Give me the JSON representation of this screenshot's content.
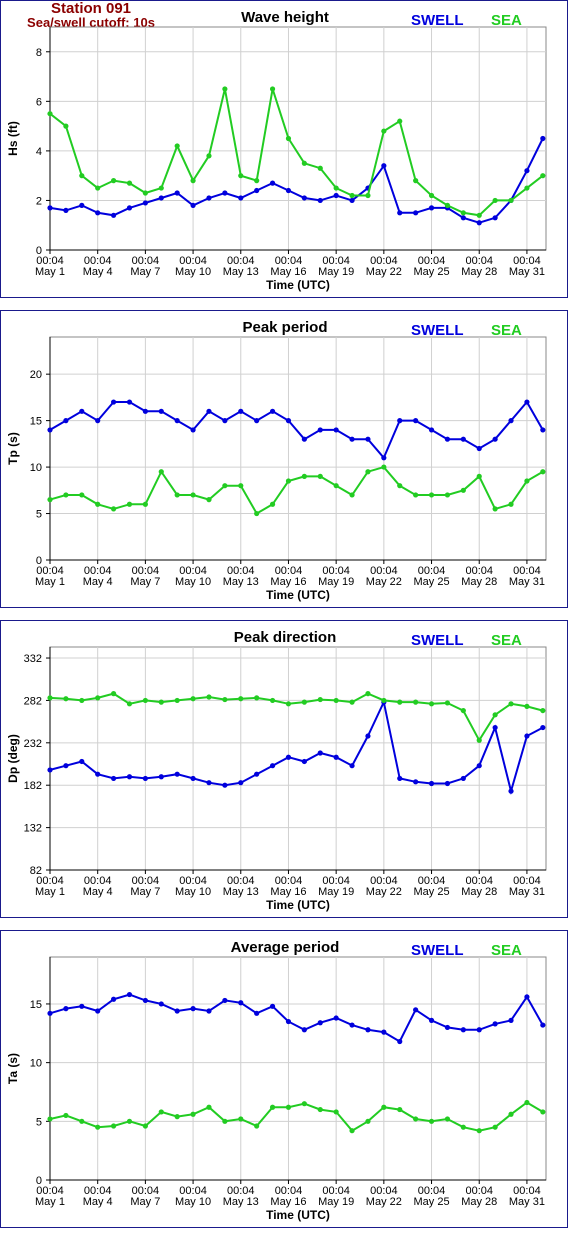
{
  "header": {
    "station": "Station 091",
    "cutoff": "Sea/swell cutoff: 10s"
  },
  "colors": {
    "swell": "#0000dd",
    "sea": "#22cc22",
    "grid": "#d0d0d0",
    "axis": "#000000",
    "frame": "#1a1a8c"
  },
  "legend": {
    "swell": "SWELL",
    "sea": "SEA"
  },
  "xaxis": {
    "label": "Time (UTC)",
    "ticks": [
      {
        "time": "00:04",
        "date": "May 1"
      },
      {
        "time": "00:04",
        "date": "May 4"
      },
      {
        "time": "00:04",
        "date": "May 7"
      },
      {
        "time": "00:04",
        "date": "May 10"
      },
      {
        "time": "00:04",
        "date": "May 13"
      },
      {
        "time": "00:04",
        "date": "May 16"
      },
      {
        "time": "00:04",
        "date": "May 19"
      },
      {
        "time": "00:04",
        "date": "May 22"
      },
      {
        "time": "00:04",
        "date": "May 25"
      },
      {
        "time": "00:04",
        "date": "May 28"
      },
      {
        "time": "00:04",
        "date": "May 31"
      }
    ]
  },
  "chart_data": [
    {
      "type": "line",
      "title": "Wave height",
      "ylabel": "Hs (ft)",
      "xlabel": "Time (UTC)",
      "ylim": [
        0,
        9
      ],
      "yticks": [
        0,
        2,
        4,
        6,
        8
      ],
      "x_unit": "day of May",
      "grid": true,
      "legend": "top-right",
      "series": [
        {
          "name": "SWELL",
          "x": [
            1,
            2,
            3,
            4,
            5,
            6,
            7,
            8,
            9,
            10,
            11,
            12,
            13,
            14,
            15,
            16,
            17,
            18,
            19,
            20,
            21,
            22,
            23,
            24,
            25,
            26,
            27,
            28,
            29,
            30,
            31,
            32
          ],
          "values": [
            1.7,
            1.6,
            1.8,
            1.5,
            1.4,
            1.7,
            1.9,
            2.1,
            2.3,
            1.8,
            2.1,
            2.3,
            2.1,
            2.4,
            2.7,
            2.4,
            2.1,
            2.0,
            2.2,
            2.0,
            2.5,
            3.4,
            1.5,
            1.5,
            1.7,
            1.7,
            1.3,
            1.1,
            1.3,
            2.0,
            3.2,
            4.5
          ]
        },
        {
          "name": "SEA",
          "x": [
            1,
            2,
            3,
            4,
            5,
            6,
            7,
            8,
            9,
            10,
            11,
            12,
            13,
            14,
            15,
            16,
            17,
            18,
            19,
            20,
            21,
            22,
            23,
            24,
            25,
            26,
            27,
            28,
            29,
            30,
            31,
            32
          ],
          "values": [
            5.5,
            5.0,
            3.0,
            2.5,
            2.8,
            2.7,
            2.3,
            2.5,
            4.2,
            2.8,
            3.8,
            6.5,
            3.0,
            2.8,
            6.5,
            4.5,
            3.5,
            3.3,
            2.5,
            2.2,
            2.2,
            4.8,
            5.2,
            2.8,
            2.2,
            1.8,
            1.5,
            1.4,
            2.0,
            2.0,
            2.5,
            3.0
          ]
        }
      ]
    },
    {
      "type": "line",
      "title": "Peak period",
      "ylabel": "Tp (s)",
      "xlabel": "Time (UTC)",
      "ylim": [
        0,
        24
      ],
      "yticks": [
        0,
        5,
        10,
        15,
        20
      ],
      "x_unit": "day of May",
      "grid": true,
      "legend": "top-right",
      "series": [
        {
          "name": "SWELL",
          "x": [
            1,
            2,
            3,
            4,
            5,
            6,
            7,
            8,
            9,
            10,
            11,
            12,
            13,
            14,
            15,
            16,
            17,
            18,
            19,
            20,
            21,
            22,
            23,
            24,
            25,
            26,
            27,
            28,
            29,
            30,
            31,
            32
          ],
          "values": [
            14,
            15,
            16,
            15,
            17,
            17,
            16,
            16,
            15,
            14,
            16,
            15,
            16,
            15,
            16,
            15,
            13,
            14,
            14,
            13,
            13,
            11,
            15,
            15,
            14,
            13,
            13,
            12,
            13,
            15,
            17,
            14
          ]
        },
        {
          "name": "SEA",
          "x": [
            1,
            2,
            3,
            4,
            5,
            6,
            7,
            8,
            9,
            10,
            11,
            12,
            13,
            14,
            15,
            16,
            17,
            18,
            19,
            20,
            21,
            22,
            23,
            24,
            25,
            26,
            27,
            28,
            29,
            30,
            31,
            32
          ],
          "values": [
            6.5,
            7,
            7,
            6,
            5.5,
            6,
            6,
            9.5,
            7,
            7,
            6.5,
            8,
            8,
            5,
            6,
            8.5,
            9,
            9,
            8,
            7,
            9.5,
            10,
            8,
            7,
            7,
            7,
            7.5,
            9,
            5.5,
            6,
            8.5,
            9.5
          ]
        }
      ]
    },
    {
      "type": "line",
      "title": "Peak direction",
      "ylabel": "Dp (deg)",
      "xlabel": "Time (UTC)",
      "ylim": [
        82,
        345
      ],
      "yticks": [
        82,
        132,
        182,
        232,
        282,
        332
      ],
      "x_unit": "day of May",
      "grid": true,
      "legend": "top-right",
      "series": [
        {
          "name": "SWELL",
          "x": [
            1,
            2,
            3,
            4,
            5,
            6,
            7,
            8,
            9,
            10,
            11,
            12,
            13,
            14,
            15,
            16,
            17,
            18,
            19,
            20,
            21,
            22,
            23,
            24,
            25,
            26,
            27,
            28,
            29,
            30,
            31,
            32
          ],
          "values": [
            200,
            205,
            210,
            195,
            190,
            192,
            190,
            192,
            195,
            190,
            185,
            182,
            185,
            195,
            205,
            215,
            210,
            220,
            215,
            205,
            240,
            280,
            190,
            186,
            184,
            184,
            190,
            205,
            250,
            175,
            240,
            250
          ]
        },
        {
          "name": "SEA",
          "x": [
            1,
            2,
            3,
            4,
            5,
            6,
            7,
            8,
            9,
            10,
            11,
            12,
            13,
            14,
            15,
            16,
            17,
            18,
            19,
            20,
            21,
            22,
            23,
            24,
            25,
            26,
            27,
            28,
            29,
            30,
            31,
            32
          ],
          "values": [
            285,
            284,
            282,
            285,
            290,
            278,
            282,
            280,
            282,
            284,
            286,
            283,
            284,
            285,
            282,
            278,
            280,
            283,
            282,
            280,
            290,
            282,
            280,
            280,
            278,
            279,
            270,
            235,
            265,
            278,
            275,
            270
          ]
        }
      ]
    },
    {
      "type": "line",
      "title": "Average period",
      "ylabel": "Ta (s)",
      "xlabel": "Time (UTC)",
      "ylim": [
        0,
        19
      ],
      "yticks": [
        0,
        5,
        10,
        15
      ],
      "x_unit": "day of May",
      "grid": true,
      "legend": "top-right",
      "series": [
        {
          "name": "SWELL",
          "x": [
            1,
            2,
            3,
            4,
            5,
            6,
            7,
            8,
            9,
            10,
            11,
            12,
            13,
            14,
            15,
            16,
            17,
            18,
            19,
            20,
            21,
            22,
            23,
            24,
            25,
            26,
            27,
            28,
            29,
            30,
            31,
            32
          ],
          "values": [
            14.2,
            14.6,
            14.8,
            14.4,
            15.4,
            15.8,
            15.3,
            15.0,
            14.4,
            14.6,
            14.4,
            15.3,
            15.1,
            14.2,
            14.8,
            13.5,
            12.8,
            13.4,
            13.8,
            13.2,
            12.8,
            12.6,
            11.8,
            14.5,
            13.6,
            13.0,
            12.8,
            12.8,
            13.3,
            13.6,
            15.6,
            13.2
          ]
        },
        {
          "name": "SEA",
          "x": [
            1,
            2,
            3,
            4,
            5,
            6,
            7,
            8,
            9,
            10,
            11,
            12,
            13,
            14,
            15,
            16,
            17,
            18,
            19,
            20,
            21,
            22,
            23,
            24,
            25,
            26,
            27,
            28,
            29,
            30,
            31,
            32
          ],
          "values": [
            5.2,
            5.5,
            5.0,
            4.5,
            4.6,
            5.0,
            4.6,
            5.8,
            5.4,
            5.6,
            6.2,
            5.0,
            5.2,
            4.6,
            6.2,
            6.2,
            6.5,
            6.0,
            5.8,
            4.2,
            5.0,
            6.2,
            6.0,
            5.2,
            5.0,
            5.2,
            4.5,
            4.2,
            4.5,
            5.6,
            6.6,
            5.8
          ]
        }
      ]
    }
  ]
}
